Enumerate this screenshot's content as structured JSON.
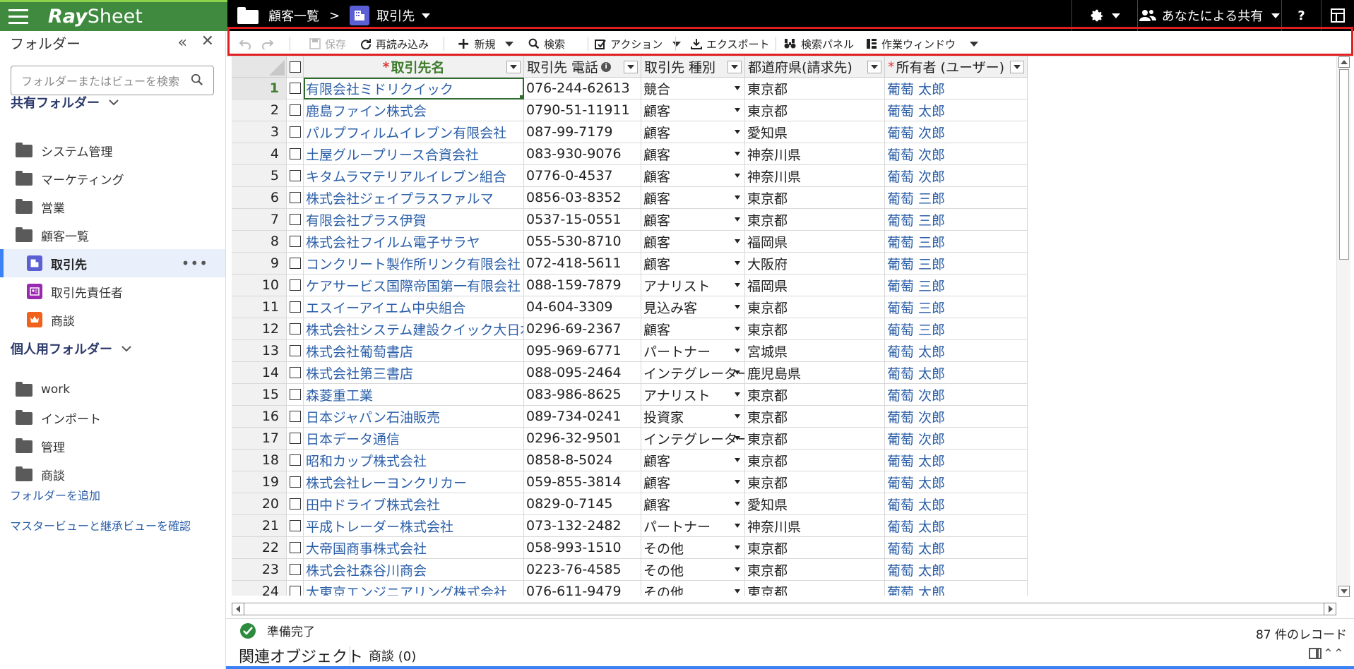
{
  "app": {
    "name_bold": "Ray",
    "name_rest": "Sheet"
  },
  "breadcrumb": {
    "parent": "顧客一覧",
    "separator": ">",
    "current": "取引先"
  },
  "topbar": {
    "share_label": "あなたによる共有",
    "help_label": "?"
  },
  "sidebar": {
    "title": "フォルダー",
    "collapse_glyph": "«",
    "close_glyph": "✕",
    "search_placeholder": "フォルダーまたはビューを検索",
    "shared_section": "共有フォルダー",
    "personal_section": "個人用フォルダー",
    "shared_items": [
      {
        "label": "システム管理",
        "icon": "folder-icon"
      },
      {
        "label": "マーケティング",
        "icon": "shared-folder-icon"
      },
      {
        "label": "営業",
        "icon": "shared-folder-icon"
      },
      {
        "label": "顧客一覧",
        "icon": "open-shared-folder-icon"
      }
    ],
    "sub_items": [
      {
        "label": "取引先",
        "icon": "building-view-icon",
        "color": "#5b5fd4",
        "active": true
      },
      {
        "label": "取引先責任者",
        "icon": "contact-card-icon",
        "color": "#9b28b0"
      },
      {
        "label": "商談",
        "icon": "crown-icon",
        "color": "#f0621c"
      }
    ],
    "personal_items": [
      {
        "label": "work"
      },
      {
        "label": "インポート"
      },
      {
        "label": "管理"
      },
      {
        "label": "商談"
      }
    ],
    "more_glyph": "•••",
    "add_folder_link": "フォルダーを追加",
    "master_view_link": "マスタービューと継承ビューを確認"
  },
  "toolbar": {
    "save": "保存",
    "reload": "再読み込み",
    "new": "新規",
    "search": "検索",
    "action": "アクション",
    "export": "エクスポート",
    "search_panel": "検索パネル",
    "work_window": "作業ウィンドウ"
  },
  "grid": {
    "columns": {
      "name": "取引先名",
      "phone": "取引先 電話",
      "type": "取引先 種別",
      "pref": "都道府県(請求先)",
      "owner": "所有者 (ユーザー)"
    },
    "required_mark": "*",
    "rows": [
      {
        "n": "1",
        "name": "有限会社ミドリクイック",
        "phone": "076-244-62613",
        "type": "競合",
        "pref": "東京都",
        "owner": "葡萄 太郎"
      },
      {
        "n": "2",
        "name": "鹿島ファイン株式会",
        "phone": "0790-51-11911",
        "type": "顧客",
        "pref": "東京都",
        "owner": "葡萄 太郎"
      },
      {
        "n": "3",
        "name": "パルプフィルムイレブン有限会社",
        "phone": "087-99-7179",
        "type": "顧客",
        "pref": "愛知県",
        "owner": "葡萄 次郎"
      },
      {
        "n": "4",
        "name": "土屋グループリース合資会社",
        "phone": "083-930-9076",
        "type": "顧客",
        "pref": "神奈川県",
        "owner": "葡萄 次郎"
      },
      {
        "n": "5",
        "name": "キタムラマテリアルイレブン組合",
        "phone": "0776-0-4537",
        "type": "顧客",
        "pref": "神奈川県",
        "owner": "葡萄 次郎"
      },
      {
        "n": "6",
        "name": "株式会社ジェイプラスファルマ",
        "phone": "0856-03-8352",
        "type": "顧客",
        "pref": "東京都",
        "owner": "葡萄 三郎"
      },
      {
        "n": "7",
        "name": "有限会社プラス伊賀",
        "phone": "0537-15-0551",
        "type": "顧客",
        "pref": "東京都",
        "owner": "葡萄 三郎"
      },
      {
        "n": "8",
        "name": "株式会社フイルム電子サラヤ",
        "phone": "055-530-8710",
        "type": "顧客",
        "pref": "福岡県",
        "owner": "葡萄 三郎"
      },
      {
        "n": "9",
        "name": "コンクリート製作所リンク有限会社",
        "phone": "072-418-5611",
        "type": "顧客",
        "pref": "大阪府",
        "owner": "葡萄 三郎"
      },
      {
        "n": "10",
        "name": "ケアサービス国際帝国第一有限会社",
        "phone": "088-159-7879",
        "type": "アナリスト",
        "pref": "福岡県",
        "owner": "葡萄 三郎"
      },
      {
        "n": "11",
        "name": "エスイーアイエム中央組合",
        "phone": "04-604-3309",
        "type": "見込み客",
        "pref": "東京都",
        "owner": "葡萄 三郎"
      },
      {
        "n": "12",
        "name": "株式会社システム建設クイック大日本",
        "phone": "0296-69-2367",
        "type": "顧客",
        "pref": "東京都",
        "owner": "葡萄 三郎"
      },
      {
        "n": "13",
        "name": "株式会社葡萄書店",
        "phone": "095-969-6771",
        "type": "パートナー",
        "pref": "宮城県",
        "owner": "葡萄 太郎"
      },
      {
        "n": "14",
        "name": "株式会社第三書店",
        "phone": "088-095-2464",
        "type": "インテグレーター",
        "pref": "鹿児島県",
        "owner": "葡萄 太郎"
      },
      {
        "n": "15",
        "name": "森菱重工業",
        "phone": "083-986-8625",
        "type": "アナリスト",
        "pref": "東京都",
        "owner": "葡萄 次郎"
      },
      {
        "n": "16",
        "name": "日本ジャパン石油販売",
        "phone": "089-734-0241",
        "type": "投資家",
        "pref": "東京都",
        "owner": "葡萄 次郎"
      },
      {
        "n": "17",
        "name": "日本データ通信",
        "phone": "0296-32-9501",
        "type": "インテグレーター",
        "pref": "東京都",
        "owner": "葡萄 次郎"
      },
      {
        "n": "18",
        "name": "昭和カップ株式会社",
        "phone": "0858-8-5024",
        "type": "顧客",
        "pref": "東京都",
        "owner": "葡萄 太郎"
      },
      {
        "n": "19",
        "name": "株式会社レーヨンクリカー",
        "phone": "059-855-3814",
        "type": "顧客",
        "pref": "東京都",
        "owner": "葡萄 太郎"
      },
      {
        "n": "20",
        "name": "田中ドライブ株式会社",
        "phone": "0829-0-7145",
        "type": "顧客",
        "pref": "愛知県",
        "owner": "葡萄 太郎"
      },
      {
        "n": "21",
        "name": "平成トレーダー株式会社",
        "phone": "073-132-2482",
        "type": "パートナー",
        "pref": "神奈川県",
        "owner": "葡萄 太郎"
      },
      {
        "n": "22",
        "name": "大帝国商事株式会社",
        "phone": "058-993-1510",
        "type": "その他",
        "pref": "東京都",
        "owner": "葡萄 太郎"
      },
      {
        "n": "23",
        "name": "株式会社森谷川商会",
        "phone": "0223-76-4585",
        "type": "その他",
        "pref": "東京都",
        "owner": "葡萄 太郎"
      },
      {
        "n": "24",
        "name": "大東京エンジニアリング株式会社",
        "phone": "076-611-9479",
        "type": "その他",
        "pref": "東京都",
        "owner": "葡萄 太郎"
      }
    ]
  },
  "status": {
    "message": "準備完了",
    "record_count": "87 件のレコード"
  },
  "related": {
    "title": "関連オブジェクト",
    "tab": "商談 (0)",
    "collapse_glyph": "⌃⌃"
  },
  "colors": {
    "brand_green": "#3f8a3f",
    "link_blue": "#2b5fa8",
    "highlight_red": "#e02020"
  }
}
